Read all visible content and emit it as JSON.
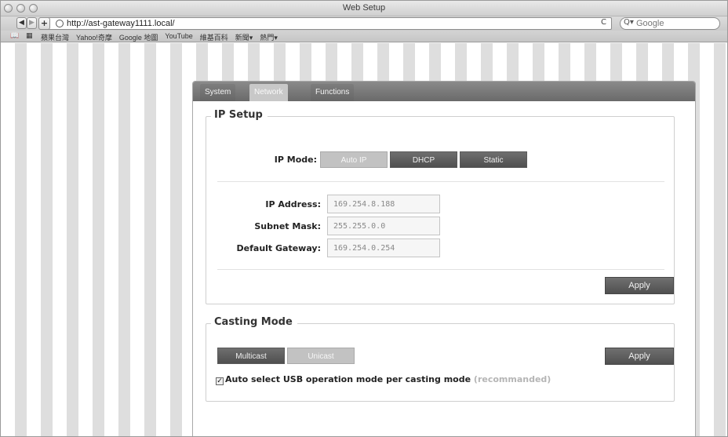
{
  "window": {
    "title": "Web Setup"
  },
  "toolbar": {
    "back": "◀",
    "forward": "▶",
    "add": "+",
    "url": "http://ast-gateway1111.local/",
    "reload": "C",
    "search_placeholder": "Google",
    "search_icon": "Q▾"
  },
  "bookmarks": {
    "book_icon": "📖",
    "grid_icon": "▦",
    "items": [
      "蘋果台灣",
      "Yahoo!奇摩",
      "Google 地圖",
      "YouTube",
      "維基百科",
      "新聞▾",
      "熱門▾"
    ]
  },
  "tabs": [
    {
      "label": "System",
      "active": false
    },
    {
      "label": "Network",
      "active": true
    },
    {
      "label": "Functions",
      "active": false
    }
  ],
  "ip_setup": {
    "title": "IP Setup",
    "mode_label": "IP Mode:",
    "modes": [
      {
        "label": "Auto IP",
        "selected": true
      },
      {
        "label": "DHCP",
        "selected": false
      },
      {
        "label": "Static",
        "selected": false
      }
    ],
    "fields": [
      {
        "label": "IP Address:",
        "value": "169.254.8.188"
      },
      {
        "label": "Subnet Mask:",
        "value": "255.255.0.0"
      },
      {
        "label": "Default Gateway:",
        "value": "169.254.0.254"
      }
    ],
    "apply_label": "Apply"
  },
  "casting_mode": {
    "title": "Casting Mode",
    "options": [
      {
        "label": "Multicast",
        "selected": false
      },
      {
        "label": "Unicast",
        "selected": true
      }
    ],
    "apply_label": "Apply",
    "auto_select_checked": true,
    "auto_select_check_glyph": "✓",
    "auto_select_label": "Auto select USB operation mode per casting mode",
    "auto_select_hint": "(recommanded)"
  },
  "colors": {
    "tab_bar": "#777777",
    "button_dark": "#5c5c5c",
    "button_selected": "#c2c2c2"
  }
}
